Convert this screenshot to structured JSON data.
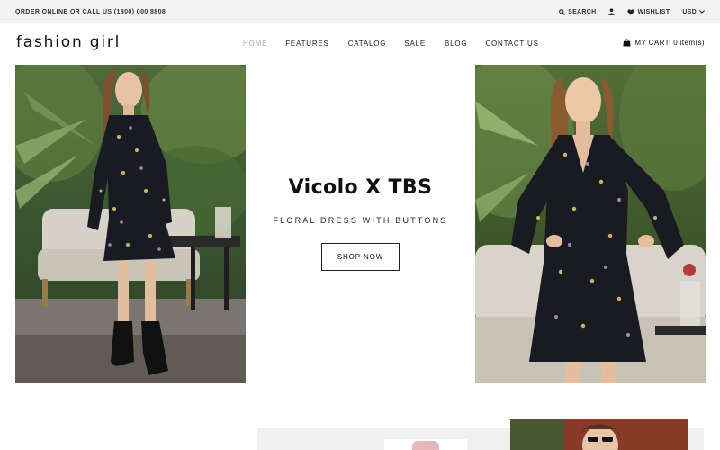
{
  "topbar": {
    "promo": "ORDER ONLINE OR CALL US (1800) 000 8808",
    "search_label": "SEARCH",
    "wishlist_label": "WISHLIST",
    "currency": "USD"
  },
  "header": {
    "logo": "fashion girl",
    "nav": [
      "HOME",
      "FEATURES",
      "CATALOG",
      "SALE",
      "BLOG",
      "CONTACT US"
    ],
    "cart_label": "MY CART: 0 item(s)"
  },
  "hero": {
    "title": "Vicolo X TBS",
    "subtitle": "FLORAL DRESS WITH BUTTONS",
    "button": "SHOP NOW"
  },
  "colors": {
    "topbar_bg": "#f2f2f2",
    "nav_active": "#aaaaaa",
    "text": "#222222"
  }
}
